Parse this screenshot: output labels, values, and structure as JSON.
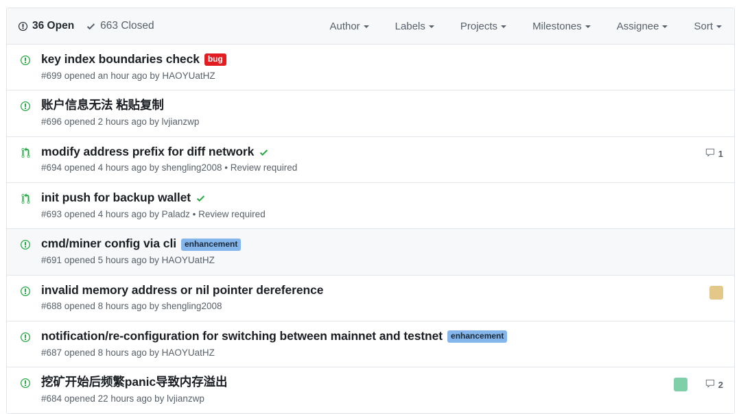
{
  "header": {
    "open": {
      "count": "36",
      "label": "36 Open",
      "icon": "issue-opened-icon"
    },
    "closed": {
      "count": "663",
      "label": "663 Closed",
      "icon": "check-icon"
    },
    "dropdowns": [
      {
        "label": "Author",
        "name": "author"
      },
      {
        "label": "Labels",
        "name": "labels"
      },
      {
        "label": "Projects",
        "name": "projects"
      },
      {
        "label": "Milestones",
        "name": "milestones"
      },
      {
        "label": "Assignee",
        "name": "assignee"
      },
      {
        "label": "Sort",
        "name": "sort"
      }
    ]
  },
  "colors": {
    "label_bug_bg": "#e11d21",
    "label_bug_fg": "#ffffff",
    "label_enhancement_bg": "#84b6eb",
    "label_enhancement_fg": "#1b2a3a",
    "issue_open_green": "#28a745",
    "pr_open_green": "#28a745",
    "border": "#e1e4e8",
    "header_bg": "#f6f8fa",
    "row_highlight_bg": "#f6f8fa",
    "meta_text": "#586069"
  },
  "rows": [
    {
      "type": "issue",
      "icon": "issue-opened-icon",
      "title": "key index boundaries check",
      "label": {
        "text": "bug",
        "bg": "#e11d21",
        "fg": "#ffffff"
      },
      "checked": false,
      "meta": "#699 opened an hour ago by HAOYUatHZ",
      "number": "#699",
      "author": "HAOYUatHZ",
      "avatar": null,
      "comments": null,
      "highlight": false
    },
    {
      "type": "issue",
      "icon": "issue-opened-icon",
      "title": "账户信息无法 粘贴复制",
      "label": null,
      "checked": false,
      "meta": "#696 opened 2 hours ago by lvjianzwp",
      "number": "#696",
      "author": "lvjianzwp",
      "avatar": null,
      "comments": null,
      "highlight": false
    },
    {
      "type": "pull-request",
      "icon": "git-pull-request-icon",
      "title": "modify address prefix for diff network",
      "label": null,
      "checked": true,
      "meta": "#694 opened 4 hours ago by shengling2008 • Review required",
      "number": "#694",
      "author": "shengling2008",
      "avatar": null,
      "comments": "1",
      "highlight": false
    },
    {
      "type": "pull-request",
      "icon": "git-pull-request-icon",
      "title": "init push for backup wallet",
      "label": null,
      "checked": true,
      "meta": "#693 opened 4 hours ago by Paladz • Review required",
      "number": "#693",
      "author": "Paladz",
      "avatar": null,
      "comments": null,
      "highlight": false
    },
    {
      "type": "issue",
      "icon": "issue-opened-icon",
      "title": "cmd/miner config via cli",
      "label": {
        "text": "enhancement",
        "bg": "#84b6eb",
        "fg": "#1b2a3a"
      },
      "checked": false,
      "meta": "#691 opened 5 hours ago by HAOYUatHZ",
      "number": "#691",
      "author": "HAOYUatHZ",
      "avatar": null,
      "comments": null,
      "highlight": true
    },
    {
      "type": "issue",
      "icon": "issue-opened-icon",
      "title": "invalid memory address or nil pointer dereference",
      "label": null,
      "checked": false,
      "meta": "#688 opened 8 hours ago by shengling2008",
      "number": "#688",
      "author": "shengling2008",
      "avatar": "#e3c88a",
      "comments": null,
      "highlight": false
    },
    {
      "type": "issue",
      "icon": "issue-opened-icon",
      "title": "notification/re-configuration for switching between mainnet and testnet",
      "label": {
        "text": "enhancement",
        "bg": "#84b6eb",
        "fg": "#1b2a3a"
      },
      "checked": false,
      "meta": "#687 opened 8 hours ago by HAOYUatHZ",
      "number": "#687",
      "author": "HAOYUatHZ",
      "avatar": null,
      "comments": null,
      "highlight": false
    },
    {
      "type": "issue",
      "icon": "issue-opened-icon",
      "title": "挖矿开始后频繁panic导致内存溢出",
      "label": null,
      "checked": false,
      "meta": "#684 opened 22 hours ago by lvjianzwp",
      "number": "#684",
      "author": "lvjianzwp",
      "avatar": "#7fd0a8",
      "comments": "2",
      "highlight": false
    }
  ]
}
